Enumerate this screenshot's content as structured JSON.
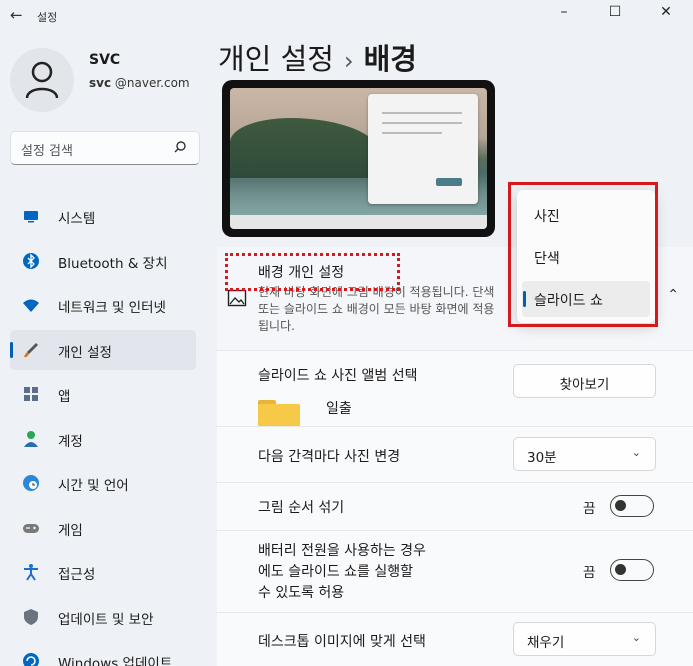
{
  "window": {
    "title": "설정",
    "back": "←",
    "minimize": "–",
    "maximize": "☐",
    "close": "✕"
  },
  "user": {
    "name": "SVC",
    "email_user": "svc",
    "email_domain": "@naver.com"
  },
  "search": {
    "placeholder": "설정 검색"
  },
  "nav": [
    {
      "label": "시스템",
      "icon": "system-icon",
      "color": "#0067c0"
    },
    {
      "label": "Bluetooth & 장치",
      "icon": "bluetooth-icon",
      "color": "#0067c0"
    },
    {
      "label": "네트워크 및 인터넷",
      "icon": "wifi-icon",
      "color": "#0067c0"
    },
    {
      "label": "개인 설정",
      "icon": "brush-icon",
      "color": "#d47c1a",
      "active": true
    },
    {
      "label": "앱",
      "icon": "apps-icon",
      "color": "#5b6f8a"
    },
    {
      "label": "계정",
      "icon": "account-icon",
      "color": "#2aa55a"
    },
    {
      "label": "시간 및 언어",
      "icon": "globe-clock-icon",
      "color": "#2b88d8"
    },
    {
      "label": "게임",
      "icon": "gamepad-icon",
      "color": "#7a7a7a"
    },
    {
      "label": "접근성",
      "icon": "accessibility-icon",
      "color": "#1b6fd1"
    },
    {
      "label": "업데이트 및 보안",
      "icon": "shield-icon",
      "color": "#6b7280"
    },
    {
      "label": "Windows 업데이트",
      "icon": "update-icon",
      "color": "#0067c0"
    }
  ],
  "breadcrumb": {
    "parent": "개인 설정",
    "separator": "›",
    "current": "배경"
  },
  "background_setting": {
    "title": "배경 개인 설정",
    "description": "현재 바탕 화면에 그림 배경이 적용됩니다. 단색 또는 슬라이드 쇼 배경이 모든 바탕 화면에 적용됩니다.",
    "options": [
      "사진",
      "단색",
      "슬라이드 쇼"
    ],
    "selected": "슬라이드 쇼"
  },
  "rows": {
    "album": {
      "label": "슬라이드 쇼 사진 앨범 선택",
      "button": "찾아보기",
      "folder": "일출"
    },
    "interval": {
      "label": "다음 간격마다 사진 변경",
      "value": "30분"
    },
    "shuffle": {
      "label": "그림 순서 섞기",
      "state": "끔"
    },
    "battery": {
      "label_lines": [
        "배터리 전원을 사용하는 경우",
        "에도 슬라이드 쇼를 실행할",
        "수 있도록 허용"
      ],
      "state": "끔"
    },
    "fit": {
      "label": "데스크톱 이미지에 맞게 선택",
      "value": "채우기"
    }
  },
  "colors": {
    "accent": "#005fb8",
    "highlight_border": "#d4191f"
  }
}
